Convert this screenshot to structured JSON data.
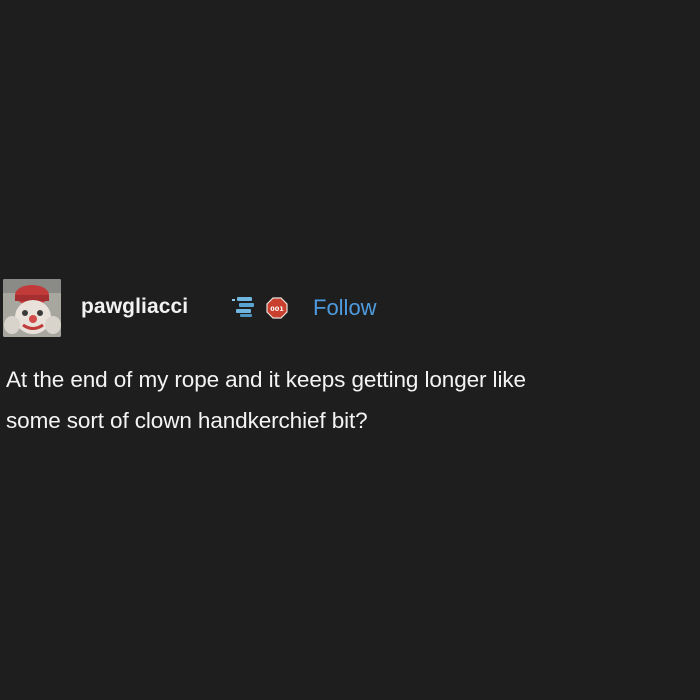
{
  "post": {
    "username": "pawgliacci",
    "follow_label": "Follow",
    "body_lines": [
      "At the end of my rope and it keeps getting longer like",
      "some sort of clown handkerchief bit?"
    ],
    "badges": [
      {
        "name": "stacked-books-badge-icon",
        "color": "#6fb6e0"
      },
      {
        "name": "stop-sign-badge-icon",
        "color": "#c9402e",
        "text": "001"
      }
    ]
  },
  "colors": {
    "background": "#1e1e1f",
    "text": "#f4f4f4",
    "link": "#4e9bdf"
  }
}
